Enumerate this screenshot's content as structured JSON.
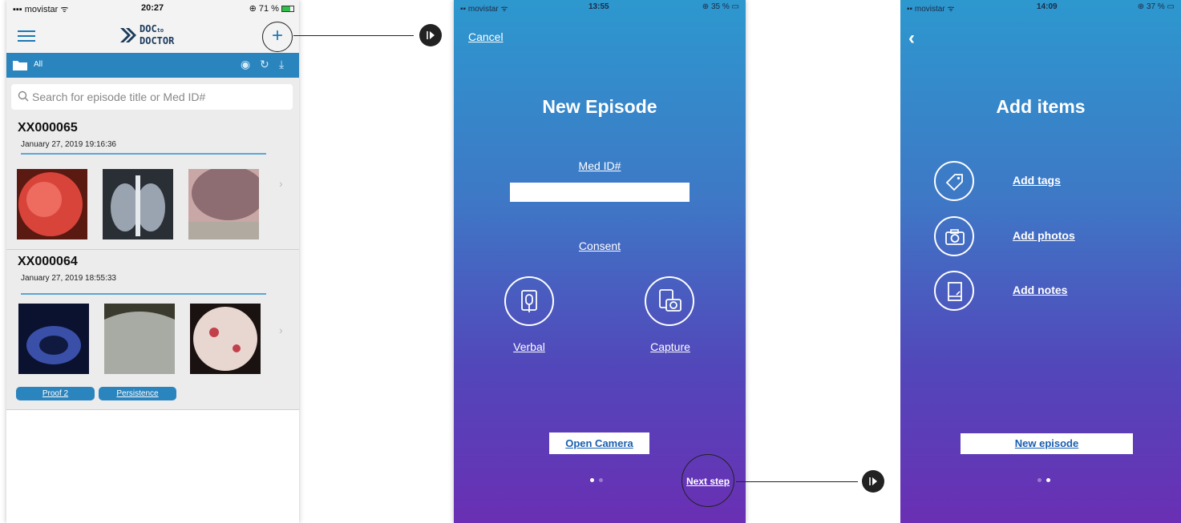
{
  "phone1": {
    "status": {
      "carrier": "movistar",
      "time": "20:27",
      "battery": "71 %",
      "battery_level": 0.71
    },
    "logo": {
      "line1": "DOC",
      "small": "to",
      "line2": "DOCTOR"
    },
    "add_label": "+",
    "filter": {
      "folder_label": "All"
    },
    "search": {
      "placeholder": "Search for episode title or Med ID#"
    },
    "episodes": [
      {
        "title": "XX000065",
        "date": "January 27, 2019 19:16:36",
        "chevron": "›"
      },
      {
        "title": "XX000064",
        "date": "January 27, 2019 18:55:33",
        "chevron": "›",
        "tags": [
          "Proof 2",
          "Persistence"
        ]
      }
    ]
  },
  "phone2": {
    "status": {
      "carrier": "movistar",
      "time": "13:55",
      "battery": "35 %"
    },
    "cancel_label": "Cancel",
    "title": "New Episode",
    "medid_label": "Med ID#",
    "medid_value": "",
    "consent_label": "Consent",
    "verbal_label": "Verbal",
    "capture_label": "Capture",
    "open_camera_label": "Open Camera",
    "next_step_label": "Next step",
    "page_indicator": {
      "total": 2,
      "active": 1
    }
  },
  "phone3": {
    "status": {
      "carrier": "movistar",
      "time": "14:09",
      "battery": "37 %"
    },
    "back_label": "‹",
    "title": "Add items",
    "items": [
      {
        "label": "Add tags",
        "icon": "tag-icon"
      },
      {
        "label": "Add photos",
        "icon": "camera-icon"
      },
      {
        "label": "Add notes",
        "icon": "note-icon"
      }
    ],
    "new_episode_label": "New episode",
    "page_indicator": {
      "total": 2,
      "active": 2
    }
  },
  "colors": {
    "brand_blue": "#2a84be",
    "gradient_top": "#2d98ce",
    "gradient_bottom": "#6a2fb4",
    "connector": "#222222"
  }
}
